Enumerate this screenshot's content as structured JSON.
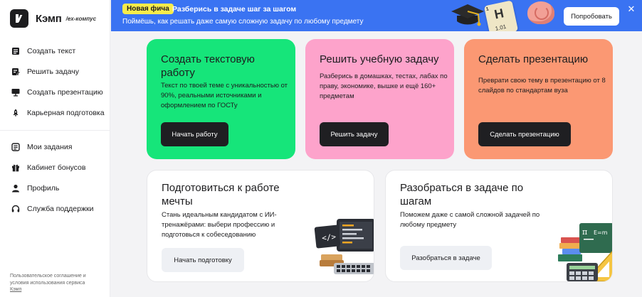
{
  "sidebar": {
    "logo": {
      "name": "Кэмп",
      "sub": "/ex-компус"
    },
    "primary": [
      {
        "label": "Создать текст",
        "icon": "text-document-icon"
      },
      {
        "label": "Решить задачу",
        "icon": "task-document-icon"
      },
      {
        "label": "Создать презентацию",
        "icon": "presentation-icon"
      },
      {
        "label": "Карьерная подготовка",
        "icon": "rocket-icon"
      }
    ],
    "secondary": [
      {
        "label": "Мои задания",
        "icon": "list-icon"
      },
      {
        "label": "Кабинет бонусов",
        "icon": "gift-icon"
      },
      {
        "label": "Профиль",
        "icon": "user-icon"
      },
      {
        "label": "Служба поддержки",
        "icon": "headphones-icon"
      }
    ],
    "footer": {
      "line1": "Пользовательское соглашение и",
      "line2": "условия использования сервиса",
      "link": "Кэмп"
    }
  },
  "banner": {
    "pill": "Новая фича",
    "title": "Разберись в задаче шаг за шагом",
    "subtitle": "Поймёшь, как решать даже самую сложную задачу по любому предмету",
    "button": "Попробовать",
    "close": "✕",
    "tile": {
      "letter": "H",
      "small": "1",
      "number": "1.01"
    },
    "colors": {
      "background": "#3a73f2",
      "pill": "#f8ec4a"
    }
  },
  "cards": {
    "text": {
      "title": "Создать текстовую работу",
      "desc": "Текст по твоей теме с уникальностью от 90%, реальными источниками и оформлением по ГОСТу",
      "button": "Начать работу",
      "color": "#16e57a"
    },
    "task": {
      "title": "Решить учебную задачу",
      "desc": "Разберись в домашках, тестах, лабах по праву, экономике, вышке и ещё 160+ предметам",
      "button": "Решить задачу",
      "color": "#fda3cb"
    },
    "presentation": {
      "title": "Сделать презентацию",
      "desc": "Преврати свою тему в презентацию от 8 слайдов по стандартам вуза",
      "button": "Сделать презентацию",
      "color": "#fb9873"
    },
    "career": {
      "title": "Подготовиться к работе мечты",
      "desc": "Стань идеальным кандидатом с ИИ-тренажёрами: выбери профессию и подготовься к собеседованию",
      "button": "Начать подготовку"
    },
    "steps": {
      "title": "Разобраться в задаче по шагам",
      "desc": "Поможем даже с самой сложной задачей по любому предмету",
      "button": "Разобраться в задаче"
    }
  }
}
